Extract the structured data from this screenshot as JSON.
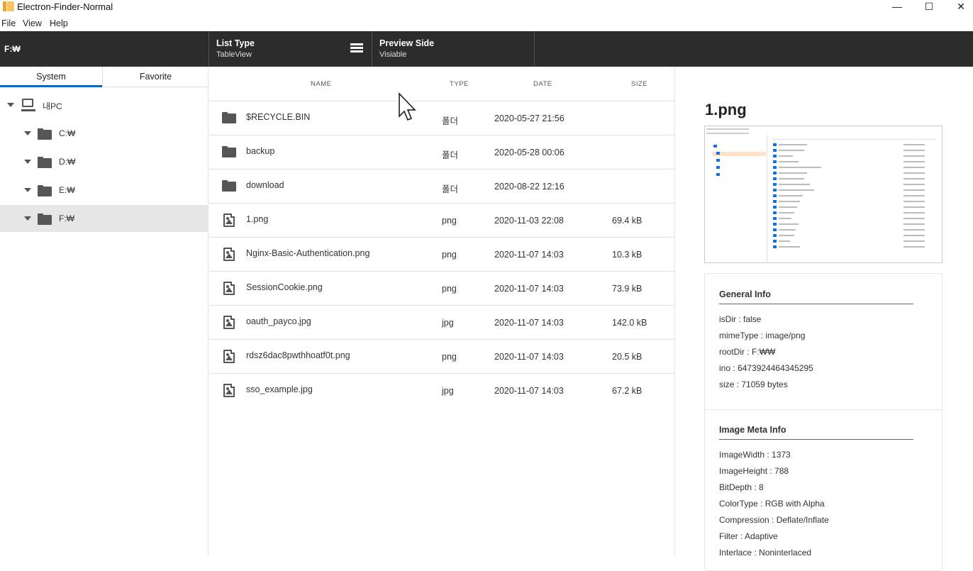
{
  "window": {
    "title": "Electron-Finder-Normal",
    "minimize": "—",
    "maximize": "☐",
    "close": "✕"
  },
  "menu": [
    "File",
    "View",
    "Help"
  ],
  "toolbar": {
    "path": "F:₩",
    "list_type": {
      "title": "List Type",
      "value": "TableView",
      "icon": "list-view-icon"
    },
    "preview_side": {
      "title": "Preview Side",
      "value": "Visiable"
    }
  },
  "sidebar": {
    "tabs": [
      {
        "label": "System",
        "active": true
      },
      {
        "label": "Favorite",
        "active": false
      }
    ],
    "tree": [
      {
        "label": "내PC",
        "icon": "computer-icon",
        "level": 0
      },
      {
        "label": "C:₩",
        "icon": "folder-icon",
        "level": 1
      },
      {
        "label": "D:₩",
        "icon": "folder-icon",
        "level": 1
      },
      {
        "label": "E:₩",
        "icon": "folder-icon",
        "level": 1
      },
      {
        "label": "F:₩",
        "icon": "folder-icon",
        "level": 1,
        "selected": true
      }
    ]
  },
  "filelist": {
    "headers": {
      "name": "NAME",
      "type": "TYPE",
      "date": "DATE",
      "size": "SIZE"
    },
    "rows": [
      {
        "name": "$RECYCLE.BIN",
        "type": "폴더",
        "date": "2020-05-27 21:56",
        "size": "",
        "kind": "folder"
      },
      {
        "name": "backup",
        "type": "폴더",
        "date": "2020-05-28 00:06",
        "size": "",
        "kind": "folder"
      },
      {
        "name": "download",
        "type": "폴더",
        "date": "2020-08-22 12:16",
        "size": "",
        "kind": "folder"
      },
      {
        "name": "1.png",
        "type": "png",
        "date": "2020-11-03 22:08",
        "size": "69.4 kB",
        "kind": "image"
      },
      {
        "name": "Nginx-Basic-Authentication.png",
        "type": "png",
        "date": "2020-11-07 14:03",
        "size": "10.3 kB",
        "kind": "image"
      },
      {
        "name": "SessionCookie.png",
        "type": "png",
        "date": "2020-11-07 14:03",
        "size": "73.9 kB",
        "kind": "image"
      },
      {
        "name": "oauth_payco.jpg",
        "type": "jpg",
        "date": "2020-11-07 14:03",
        "size": "142.0 kB",
        "kind": "image"
      },
      {
        "name": "rdsz6dac8pwthhoatf0t.png",
        "type": "png",
        "date": "2020-11-07 14:03",
        "size": "20.5 kB",
        "kind": "image"
      },
      {
        "name": "sso_example.jpg",
        "type": "jpg",
        "date": "2020-11-07 14:03",
        "size": "67.2 kB",
        "kind": "image"
      }
    ]
  },
  "preview": {
    "title": "1.png",
    "general_title": "General Info",
    "general": [
      "isDir : false",
      "mimeType : image/png",
      "rootDir : F:₩₩",
      "ino : 6473924464345295",
      "size : 71059 bytes"
    ],
    "meta_title": "Image Meta Info",
    "meta": [
      "ImageWidth : 1373",
      "ImageHeight : 788",
      "BitDepth : 8",
      "ColorType : RGB with Alpha",
      "Compression : Deflate/Inflate",
      "Filter : Adaptive",
      "Interlace : Noninterlaced"
    ]
  },
  "colors": {
    "toolbar_bg": "#2c2c2c",
    "tab_active": "#1565c0",
    "selected_row": "#e6e6e6"
  }
}
